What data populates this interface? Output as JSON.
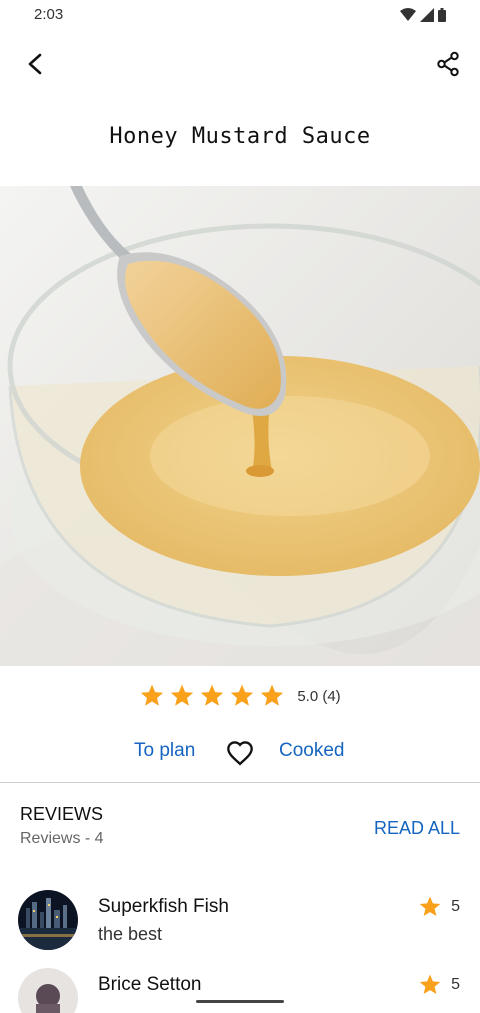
{
  "status_bar": {
    "time": "2:03"
  },
  "recipe": {
    "title": "Honey Mustard Sauce"
  },
  "rating": {
    "stars": 5,
    "max_stars": 5,
    "label": "5.0 (4)",
    "star_color": "#f9a11b"
  },
  "actions": {
    "plan_label": "To plan",
    "cooked_label": "Cooked",
    "link_color": "#1565c0"
  },
  "reviews": {
    "title": "REVIEWS",
    "count_label": "Reviews - 4",
    "read_all_label": "READ ALL",
    "items": [
      {
        "name": "Superkfish Fish",
        "text": "the best",
        "score": "5"
      },
      {
        "name": "Brice Setton",
        "text": "",
        "score": "5"
      }
    ]
  }
}
